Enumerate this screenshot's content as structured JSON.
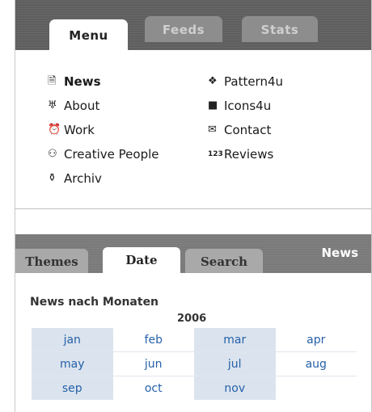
{
  "top_tabs": [
    {
      "label": "Menu"
    },
    {
      "label": "Feeds"
    },
    {
      "label": "Stats"
    }
  ],
  "menu": {
    "left": [
      {
        "label": "News",
        "icon": "document-icon",
        "glyph": "🗎"
      },
      {
        "label": "About",
        "icon": "person-icon",
        "glyph": "♅"
      },
      {
        "label": "Work",
        "icon": "clock-icon",
        "glyph": "⏰"
      },
      {
        "label": "Creative People",
        "icon": "people-icon",
        "glyph": "⚇"
      },
      {
        "label": "Archiv",
        "icon": "archive-icon",
        "glyph": "⚱"
      }
    ],
    "right": [
      {
        "label": "Pattern4u",
        "icon": "pattern-icon",
        "glyph": "❖"
      },
      {
        "label": "Icons4u",
        "icon": "square-icon",
        "glyph": "■"
      },
      {
        "label": "Contact",
        "icon": "mail-icon",
        "glyph": "✉"
      },
      {
        "label": "Reviews",
        "icon": "numbers-icon",
        "glyph": "123"
      }
    ]
  },
  "bottom_tabs": [
    {
      "label": "Themes"
    },
    {
      "label": "Date"
    },
    {
      "label": "Search"
    }
  ],
  "bar2_title": "News",
  "archive": {
    "heading": "News nach Monaten",
    "year": "2006",
    "months": [
      [
        "jan",
        "feb",
        "mar",
        "apr"
      ],
      [
        "may",
        "jun",
        "jul",
        "aug"
      ],
      [
        "sep",
        "oct",
        "nov",
        ""
      ]
    ]
  },
  "colors": {
    "bar": "#5f5f5f",
    "link": "#2660a8",
    "cell_shade": "#dbe4ee"
  }
}
